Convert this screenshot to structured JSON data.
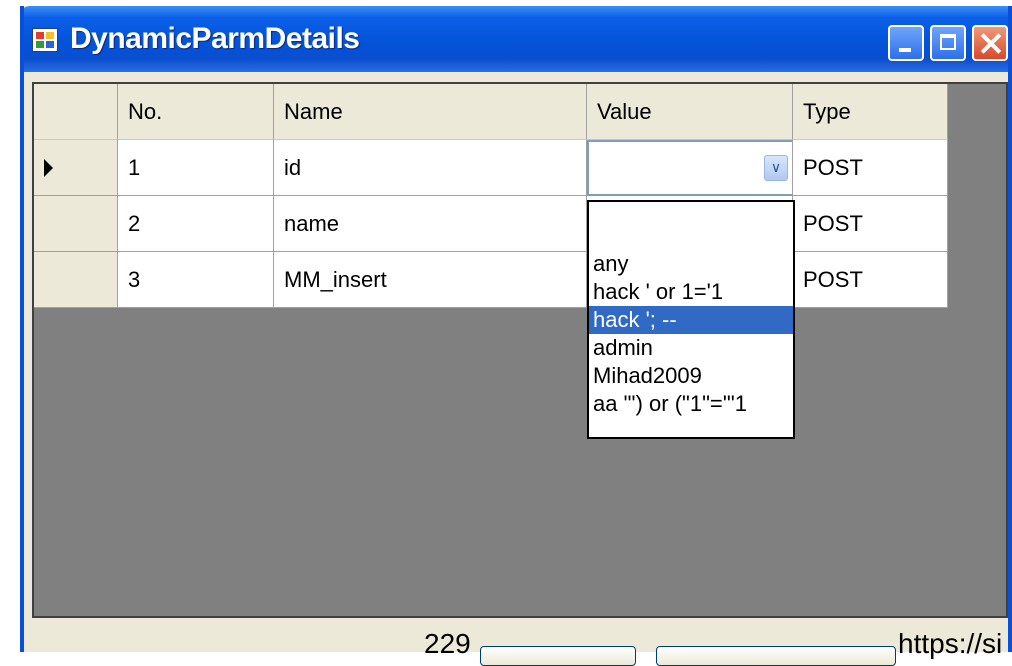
{
  "window": {
    "title": "DynamicParmDetails"
  },
  "grid": {
    "columns": [
      "No.",
      "Name",
      "Value",
      "Type"
    ],
    "rows": [
      {
        "no": "1",
        "name": "id",
        "value": "",
        "type": "POST",
        "current": true
      },
      {
        "no": "2",
        "name": "name",
        "value": "",
        "type": "POST"
      },
      {
        "no": "3",
        "name": "MM_insert",
        "value": "",
        "type": "POST"
      }
    ]
  },
  "dropdown": {
    "options": [
      "",
      "any",
      "hack ' or 1='1",
      "hack '; --",
      "admin",
      "Mihad2009",
      " aa \"') or (\"1\"='\"1"
    ],
    "selected": "hack '; --"
  },
  "overlay": {
    "page_number": "229",
    "url_fragment": "https://si"
  },
  "colors": {
    "titlebar": "#0453d8",
    "selection": "#316ac5",
    "grid_bg": "#808080",
    "chrome": "#ece9d8"
  }
}
